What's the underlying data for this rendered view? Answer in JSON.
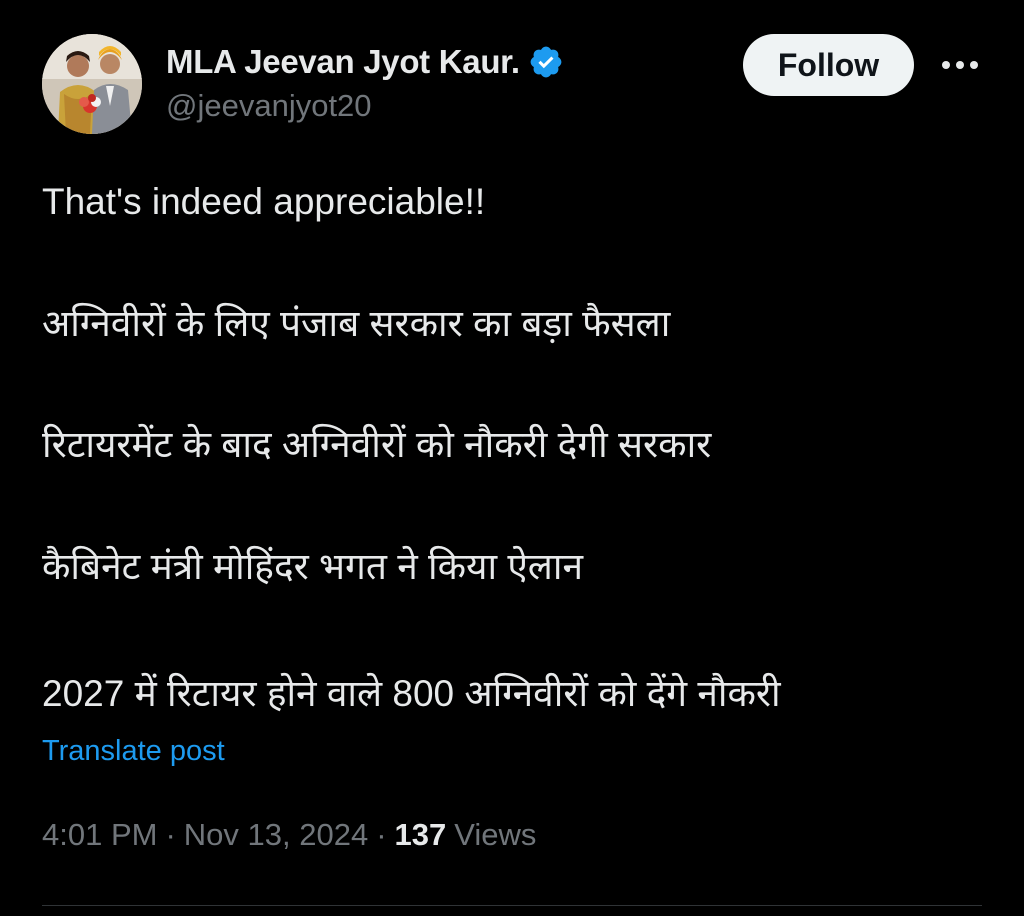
{
  "author": {
    "display_name": "MLA Jeevan Jyot Kaur.",
    "handle": "@jeevanjyot20",
    "verified_icon": "verified-badge-icon",
    "avatar_icon": "profile-photo"
  },
  "actions": {
    "follow_label": "Follow",
    "more_icon": "more-horizontal-icon"
  },
  "post": {
    "lines": [
      "That's indeed appreciable!!",
      "अग्निवीरों के लिए पंजाब सरकार का बड़ा फैसला",
      "रिटायरमेंट के बाद अग्निवीरों को नौकरी देगी सरकार",
      "कैबिनेट मंत्री मोहिंदर भगत ने किया ऐलान",
      "2027 में रिटायर होने वाले 800 अग्निवीरों को देंगे नौकरी"
    ],
    "translate_label": "Translate post"
  },
  "meta": {
    "time": "4:01 PM",
    "separator": "·",
    "date": "Nov 13, 2024",
    "views_count": "137",
    "views_label": "Views"
  },
  "colors": {
    "background": "#000000",
    "text": "#e7e9ea",
    "secondary": "#71767b",
    "accent": "#1d9bf0"
  }
}
